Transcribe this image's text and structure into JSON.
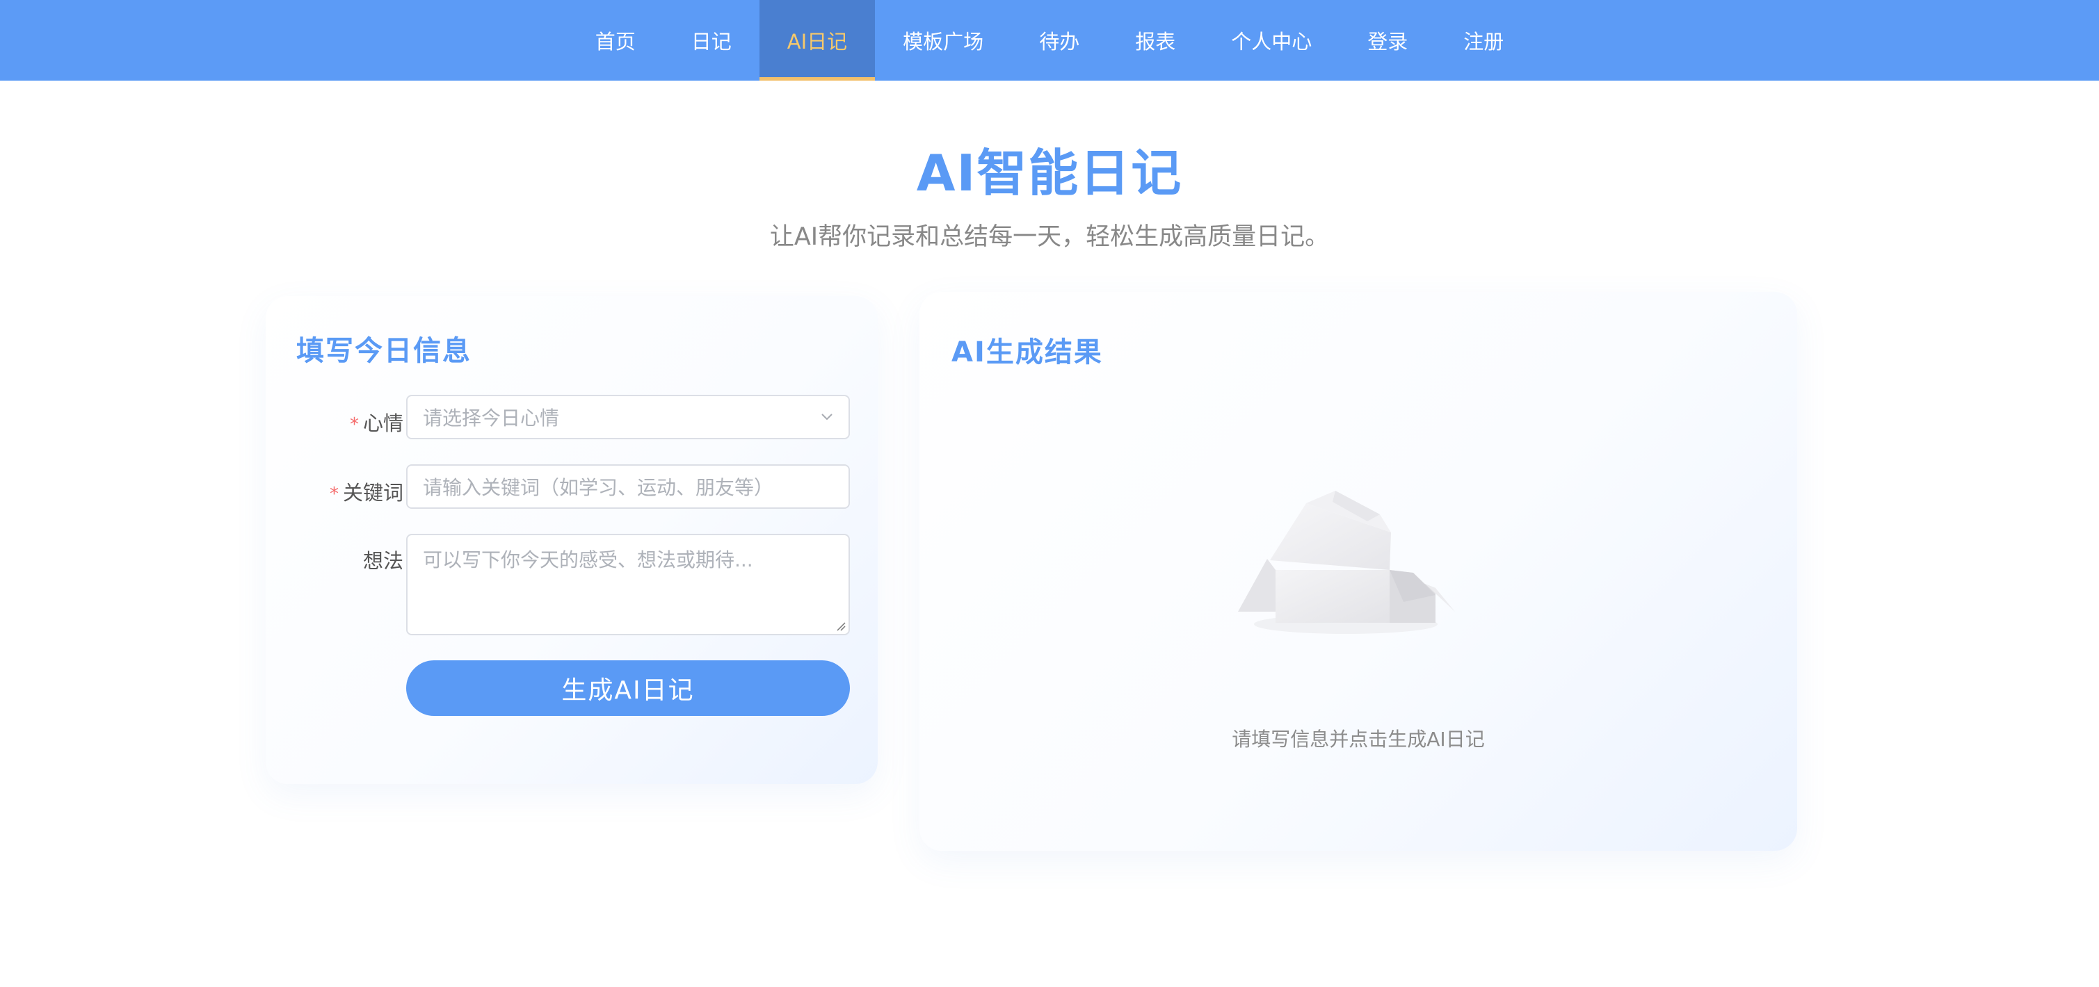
{
  "nav": {
    "items": [
      "首页",
      "日记",
      "AI日记",
      "模板广场",
      "待办",
      "报表",
      "个人中心",
      "登录",
      "注册"
    ],
    "active": "AI日记"
  },
  "header": {
    "title": "AI智能日记",
    "subtitle": "让AI帮你记录和总结每一天，轻松生成高质量日记。"
  },
  "form": {
    "title": "填写今日信息",
    "required_mark": "*",
    "mood": {
      "label": "心情",
      "placeholder": "请选择今日心情"
    },
    "keywords": {
      "label": "关键词",
      "placeholder": "请输入关键词（如学习、运动、朋友等）"
    },
    "thoughts": {
      "label": "想法",
      "placeholder": "可以写下你今天的感受、想法或期待..."
    },
    "submit_label": "生成AI日记"
  },
  "result": {
    "title": "AI生成结果",
    "empty_text": "请填写信息并点击生成AI日记"
  },
  "colors": {
    "nav_bg": "#5c9bf6",
    "nav_active_bg": "#4a7fd0",
    "nav_active_text": "#f7c96a",
    "accent": "#5a9af5",
    "required": "#f56c6c"
  }
}
